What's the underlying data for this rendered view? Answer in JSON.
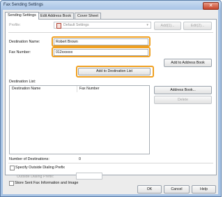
{
  "window": {
    "title": "Fax Sending Settings",
    "close_glyph": "✕"
  },
  "tabs": [
    {
      "label": "Sending Settings",
      "active": true
    },
    {
      "label": "Edit Address Book",
      "active": false
    },
    {
      "label": "Cover Sheet",
      "active": false
    }
  ],
  "profile": {
    "label": "Profile:",
    "value": "Default Settings",
    "add_label": "Add(1)...",
    "edit_label": "Edit(2)..."
  },
  "destination": {
    "name_label": "Destination Name:",
    "name_value": "Robert Brown",
    "number_label": "Fax Number:",
    "number_value": "012xxxxxx",
    "add_to_address_book": "Add to Address Book",
    "add_to_destination_list": "Add to Destination List"
  },
  "destination_list": {
    "label": "Destination List:",
    "columns": [
      "Destination Name",
      "Fax Number"
    ],
    "rows": [],
    "address_book_button": "Address Book...",
    "delete_button": "Delete",
    "count_label": "Number of Destinations:",
    "count_value": "0"
  },
  "options": {
    "specify_prefix_label": "Specify Outside Dialing Prefix",
    "specify_prefix_checked": false,
    "prefix_label": "Outside Dialing Prefix:",
    "prefix_value": "",
    "store_sent_label": "Store Sent Fax Information and Image",
    "store_sent_checked": false
  },
  "footer": {
    "ok": "OK",
    "cancel": "Cancel",
    "help": "Help"
  },
  "colors": {
    "highlight": "#f0a020",
    "title_bar": "#a8c4e6"
  },
  "icons": {
    "profile": "fax-profile-icon",
    "dropdown": "chevron-down-icon"
  }
}
